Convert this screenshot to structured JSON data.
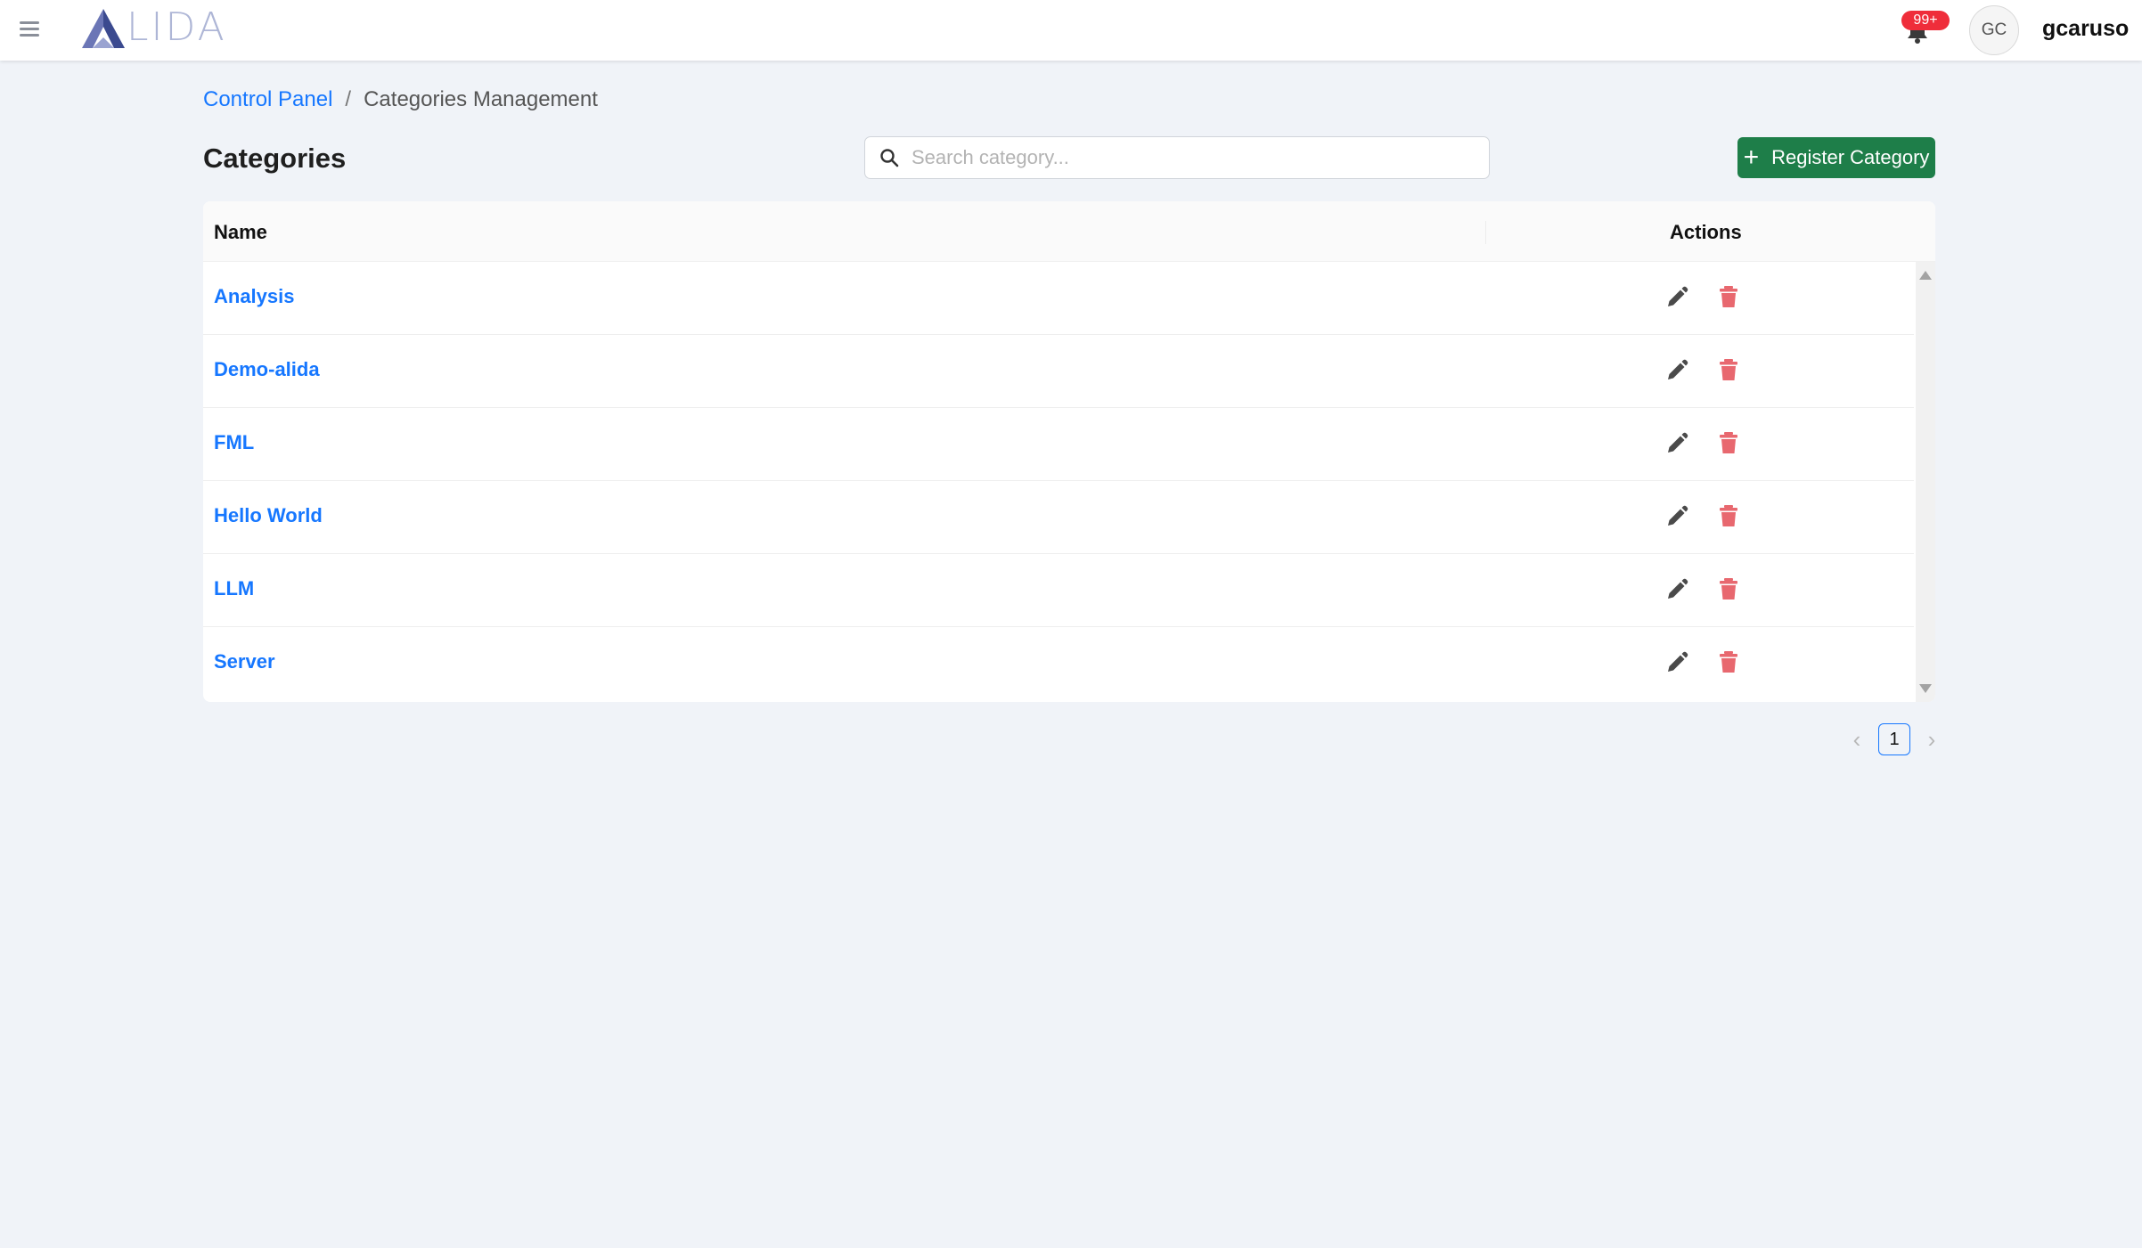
{
  "header": {
    "logo_text": "LIDA",
    "notifications_badge": "99+",
    "avatar_initials": "GC",
    "username": "gcaruso"
  },
  "breadcrumb": {
    "root": "Control Panel",
    "separator": "/",
    "current": "Categories Management"
  },
  "page": {
    "title": "Categories",
    "search_placeholder": "Search category...",
    "register_label": "Register Category"
  },
  "table": {
    "headers": {
      "name": "Name",
      "actions": "Actions"
    },
    "rows": [
      {
        "name": "Analysis"
      },
      {
        "name": "Demo-alida"
      },
      {
        "name": "FML"
      },
      {
        "name": "Hello World"
      },
      {
        "name": "LLM"
      },
      {
        "name": "Server"
      }
    ]
  },
  "pagination": {
    "current_page": "1",
    "prev_symbol": "‹",
    "next_symbol": "›"
  },
  "colors": {
    "link": "#1677ff",
    "primary_green": "#1e7e49",
    "delete_red": "#e8686f",
    "badge_red": "#ef2d3a",
    "background": "#f0f3f8"
  }
}
